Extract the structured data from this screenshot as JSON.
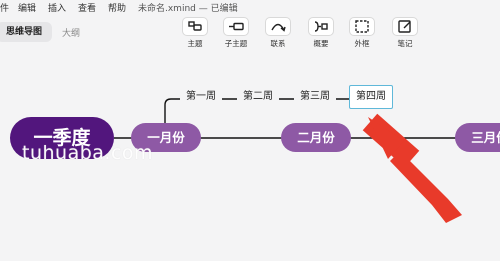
{
  "menu": [
    "件",
    "编辑",
    "插入",
    "查看",
    "帮助"
  ],
  "doc_title": "未命名.xmind — 已编辑",
  "tabs": {
    "active": "思维导图",
    "other": "大纲"
  },
  "toolbar": [
    {
      "label": "主题",
      "icon": "topic-icon"
    },
    {
      "label": "子主题",
      "icon": "subtopic-icon"
    },
    {
      "label": "联系",
      "icon": "relationship-icon"
    },
    {
      "label": "概要",
      "icon": "summary-icon"
    },
    {
      "label": "外框",
      "icon": "boundary-icon"
    },
    {
      "label": "笔记",
      "icon": "note-icon"
    }
  ],
  "mindmap": {
    "root": "一季度",
    "branches": [
      "一月份",
      "二月份",
      "三月份"
    ],
    "subtopics": [
      "第一周",
      "第二周",
      "第三周",
      "第四周"
    ],
    "selected_subtopic": "第四周"
  },
  "watermark": "tuhuaba.com",
  "colors": {
    "root": "#52167d",
    "branch": "#8e59a5",
    "selection": "#5fb8d9",
    "arrow": "#e83a2a",
    "canvas": "#f4f4f5"
  }
}
